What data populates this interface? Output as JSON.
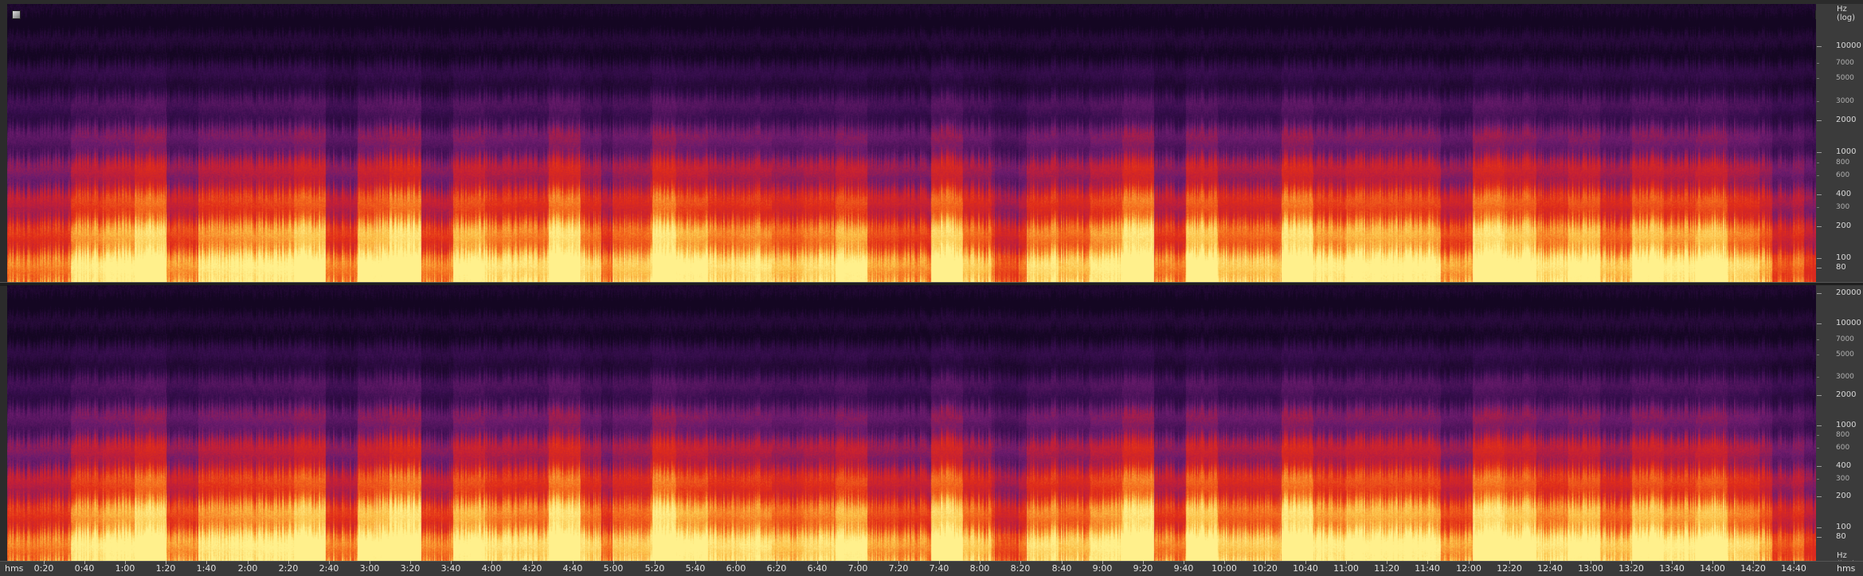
{
  "app": {
    "view": "spectral-frequency-display"
  },
  "frequency_axis": {
    "unit_label": "Hz (log)",
    "labels": [
      "20000",
      "10000",
      "7000",
      "5000",
      "3000",
      "2000",
      "1000",
      "800",
      "600",
      "400",
      "300",
      "200",
      "100",
      "80"
    ]
  },
  "time_axis": {
    "unit_label": "hms",
    "labels": [
      "0:20",
      "0:40",
      "1:00",
      "1:20",
      "1:40",
      "2:00",
      "2:20",
      "2:40",
      "3:00",
      "3:20",
      "3:40",
      "4:00",
      "4:20",
      "4:40",
      "5:00",
      "5:20",
      "5:40",
      "6:00",
      "6:20",
      "6:40",
      "7:00",
      "7:20",
      "7:40",
      "8:00",
      "8:20",
      "8:40",
      "9:00",
      "9:20",
      "9:40",
      "10:00",
      "10:20",
      "10:40",
      "11:00",
      "11:20",
      "11:40",
      "12:00",
      "12:20",
      "12:40",
      "13:00",
      "13:20",
      "13:40",
      "14:00",
      "14:20",
      "14:40"
    ]
  },
  "colors": {
    "background": "#2b2b2b",
    "spectrum_low": "#1a0828",
    "spectrum_mid": "#d12a1e",
    "spectrum_high": "#ffe878"
  }
}
